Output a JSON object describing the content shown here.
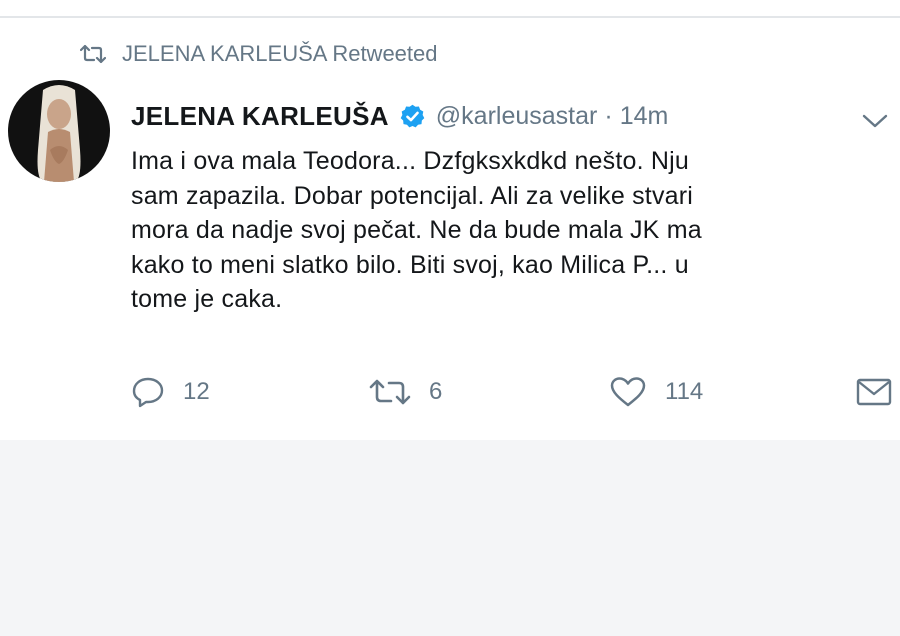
{
  "retweet_context": {
    "icon": "retweet-icon",
    "text": "JELENA KARLEUŠA Retweeted"
  },
  "tweet": {
    "display_name": "JELENA KARLEUŠA",
    "verified_icon": "verified-badge-icon",
    "handle": "@karleusastar",
    "separator": "·",
    "time": "14m",
    "menu_icon": "chevron-down-icon",
    "text_lines": [
      "Ima i ova mala Teodora... Dzfgksxkdkd nešto. Nju",
      "sam zapazila. Dobar potencijal. Ali za velike stvari",
      "mora da nadje svoj pečat. Ne da bude mala JK ma",
      "kako to meni slatko bilo. Biti svoj, kao Milica P... u",
      "tome je caka."
    ]
  },
  "actions": {
    "reply": {
      "icon": "reply-icon",
      "count": "12"
    },
    "retweet": {
      "icon": "retweet-icon",
      "count": "6"
    },
    "like": {
      "icon": "heart-icon",
      "count": "114"
    },
    "message": {
      "icon": "envelope-icon"
    }
  },
  "colors": {
    "text_primary": "#14171a",
    "text_secondary": "#657786",
    "verified_blue": "#1da1f2",
    "background": "#f4f5f7"
  }
}
